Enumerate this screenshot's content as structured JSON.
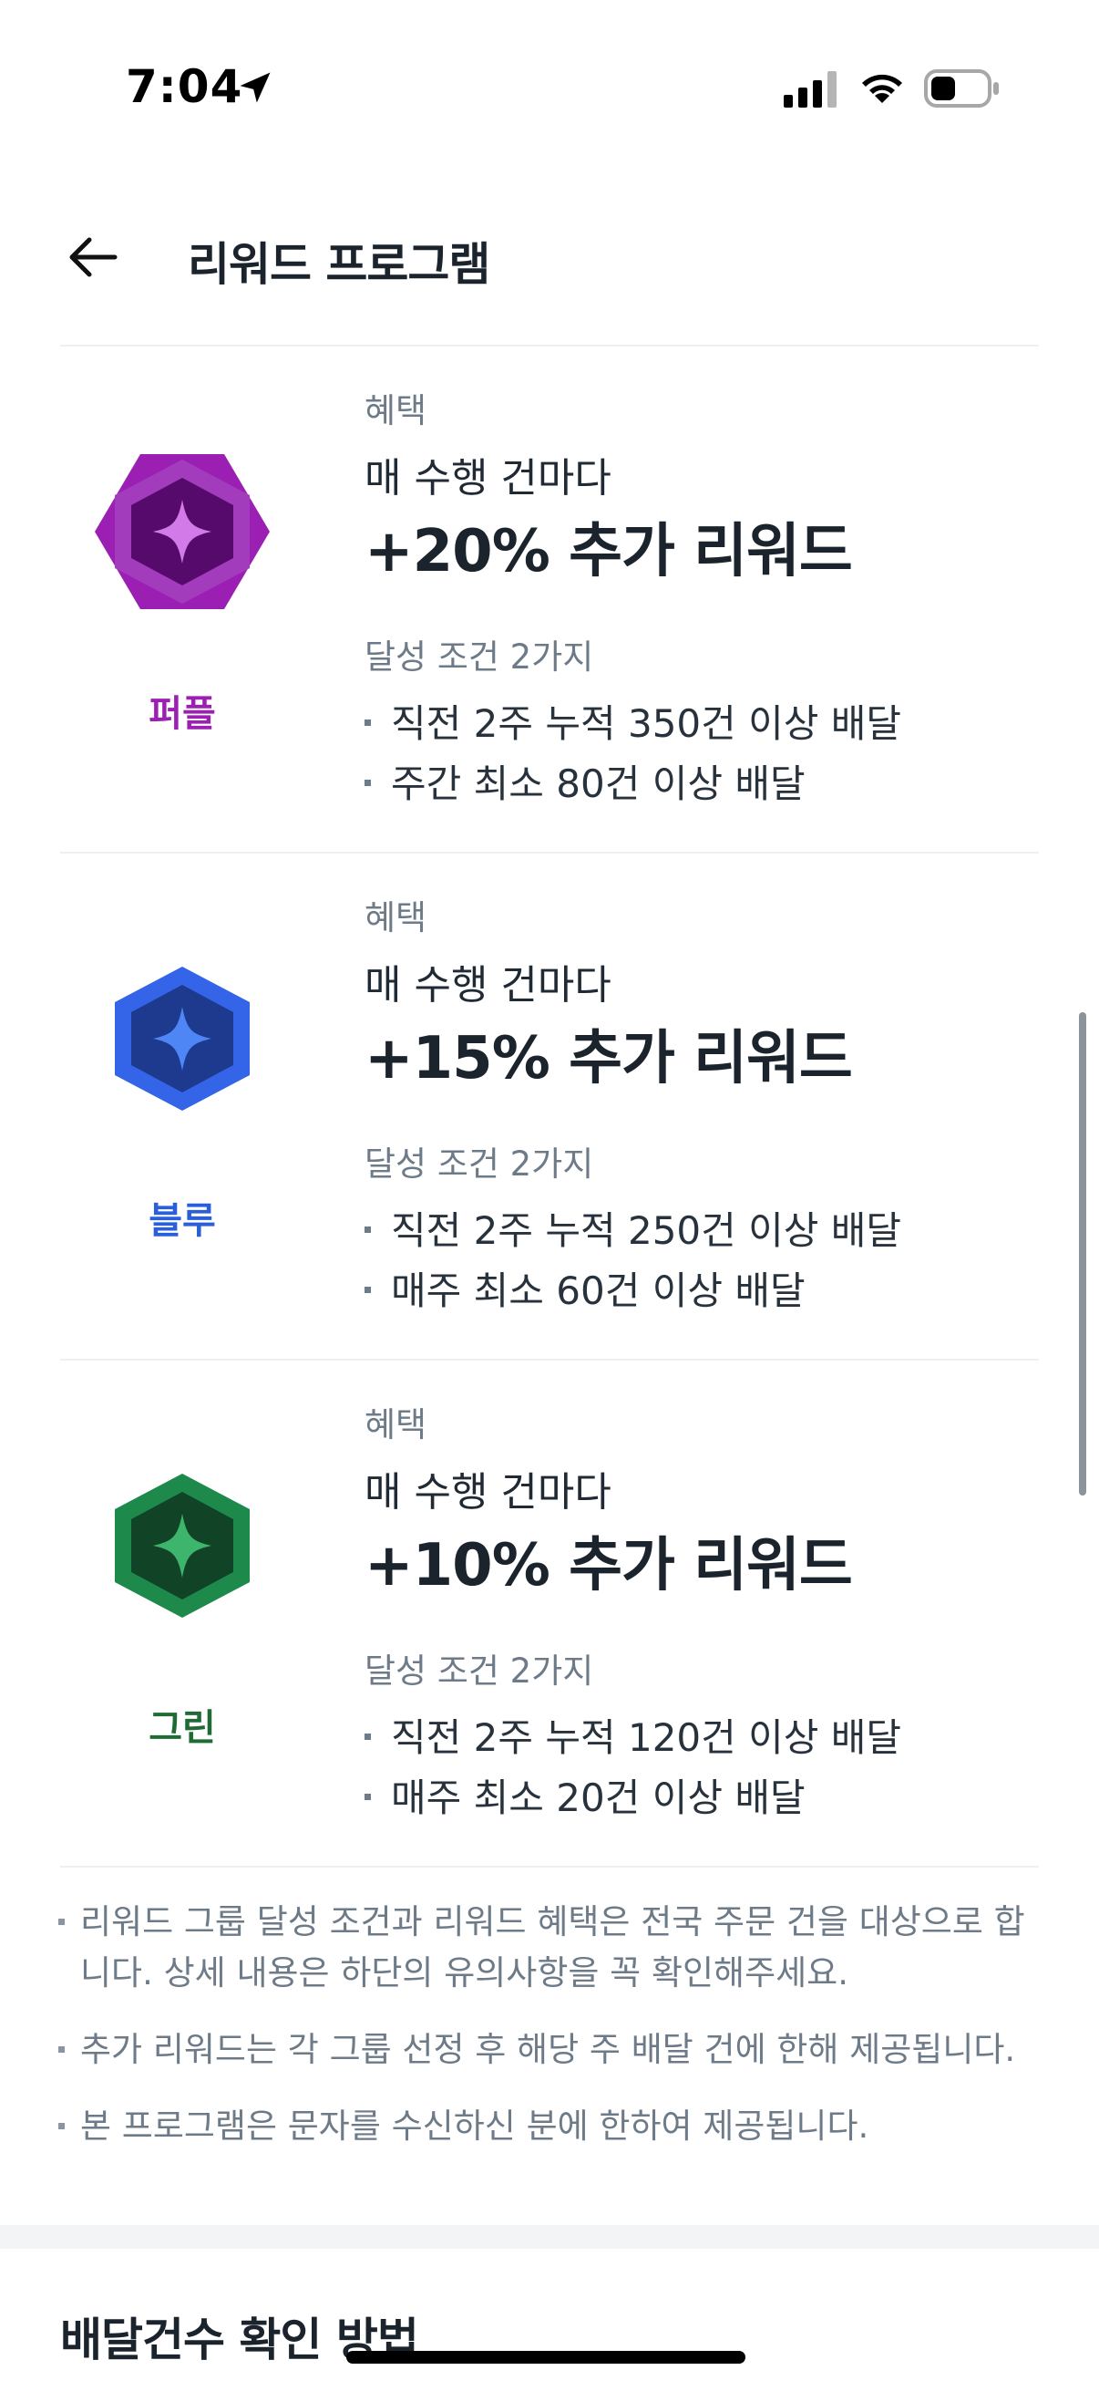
{
  "status_bar": {
    "time": "7:04"
  },
  "header": {
    "title": "리워드 프로그램"
  },
  "tiers": [
    {
      "name": "퍼플",
      "color": "#9c1fb4",
      "benefit_label": "혜택",
      "per_delivery": "매 수행 건마다",
      "reward": "+20% 추가 리워드",
      "conditions_label": "달성 조건 2가지",
      "conditions": [
        "직전 2주 누적 350건 이상 배달",
        "주간 최소 80건 이상 배달"
      ]
    },
    {
      "name": "블루",
      "color": "#2b5fd9",
      "benefit_label": "혜택",
      "per_delivery": "매 수행 건마다",
      "reward": "+15% 추가 리워드",
      "conditions_label": "달성 조건 2가지",
      "conditions": [
        "직전 2주 누적 250건 이상 배달",
        "매주 최소 60건 이상 배달"
      ]
    },
    {
      "name": "그린",
      "color": "#1f6b34",
      "benefit_label": "혜택",
      "per_delivery": "매 수행 건마다",
      "reward": "+10% 추가 리워드",
      "conditions_label": "달성 조건 2가지",
      "conditions": [
        "직전 2주 누적 120건 이상 배달",
        "매주 최소 20건 이상 배달"
      ]
    }
  ],
  "notes": [
    "리워드 그룹 달성 조건과 리워드 혜택은 전국 주문 건을 대상으로 합니다. 상세 내용은 하단의 유의사항을 꼭 확인해주세요.",
    "추가 리워드는 각 그룹 선정 후 해당 주 배달 건에 한해 제공됩니다.",
    "본 프로그램은 문자를 수신하신 분에 한하여 제공됩니다."
  ],
  "next_section": {
    "title": "배달건수 확인 방법"
  },
  "icons": {
    "back": "arrow-left-icon",
    "location": "location-arrow-icon",
    "signal": "cellular-signal-icon",
    "wifi": "wifi-icon",
    "battery": "battery-icon"
  }
}
